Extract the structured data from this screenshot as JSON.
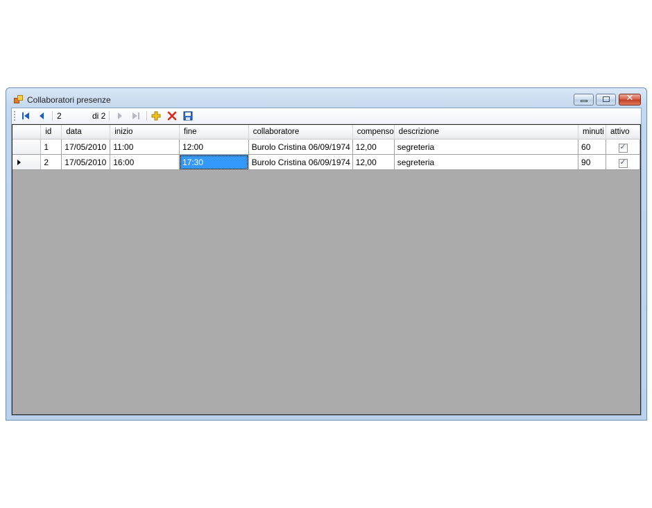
{
  "window": {
    "title": "Collaboratori presenze",
    "close_glyph": "✕"
  },
  "navigator": {
    "position": "2",
    "count_label": "di 2",
    "icons": [
      "move-first-icon",
      "move-previous-icon",
      "move-next-icon",
      "move-last-icon",
      "add-new-icon",
      "delete-icon",
      "save-icon"
    ]
  },
  "grid": {
    "columns": [
      "id",
      "data",
      "inizio",
      "fine",
      "collaboratore",
      "compenso",
      "descrizione",
      "minuti",
      "attivo"
    ],
    "rows": [
      {
        "id": "1",
        "data": "17/05/2010",
        "inizio": "11:00",
        "fine": "12:00",
        "collaboratore": "Burolo Cristina 06/09/1974",
        "compenso": "12,00",
        "descrizione": "segreteria",
        "minuti": "60",
        "attivo": "✓"
      },
      {
        "id": "2",
        "data": "17/05/2010",
        "inizio": "16:00",
        "fine": "17:30",
        "collaboratore": "Burolo Cristina 06/09/1974",
        "compenso": "12,00",
        "descrizione": "segreteria",
        "minuti": "90",
        "attivo": "✓"
      }
    ],
    "current_row_indicator": "row 2",
    "selected_cell": "row 2 / fine"
  },
  "colors": {
    "selection": "#3399ff",
    "grid_background": "#ababab",
    "accent_blue": "#1c5ec9",
    "delete_red": "#e0251b",
    "add_yellow": "#f0c419"
  }
}
